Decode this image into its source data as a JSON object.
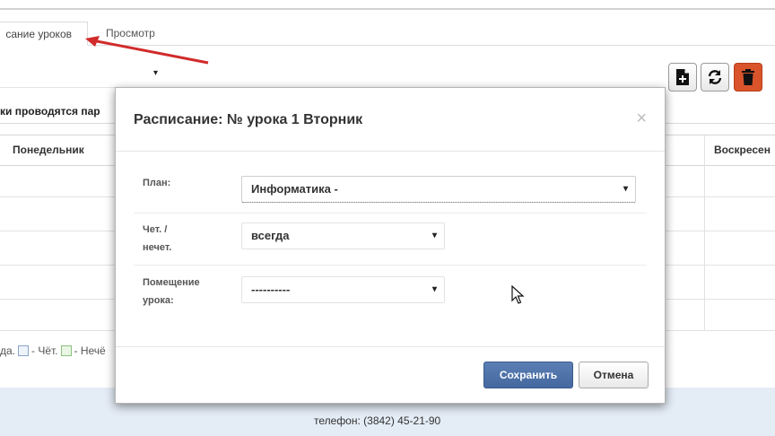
{
  "tabs": [
    {
      "label": "сание уроков"
    },
    {
      "label": "Просмотр"
    }
  ],
  "class_select": {
    "value": "",
    "caret": "▾"
  },
  "toolbar": {
    "new_icon": "file-plus-icon",
    "refresh_icon": "refresh-icon",
    "delete_icon": "trash-icon"
  },
  "notice": "ки проводятся пар",
  "grid": {
    "headers": [
      "Понедельник",
      "Воскресен"
    ]
  },
  "legend": {
    "prefix": "да.",
    "even": "- Чёт.",
    "odd": "- Нечё"
  },
  "footer": {
    "phone": "телефон: (3842) 45-21-90"
  },
  "modal": {
    "title": "Расписание: № урока 1 Вторник",
    "close": "×",
    "plan_label": "План:",
    "plan_value": "Информатика -",
    "parity_label_1": "Чет. /",
    "parity_label_2": "нечет.",
    "parity_value": "всегда",
    "room_label_1": "Помещение",
    "room_label_2": "урока:",
    "room_value": "----------",
    "caret": "▾",
    "save": "Сохранить",
    "cancel": "Отмена"
  },
  "colors": {
    "accent_red_arrow": "#d12b2b",
    "save_button": "#4d72a9",
    "delete_button": "#d9542a",
    "footer_band": "#e4ecf6"
  }
}
